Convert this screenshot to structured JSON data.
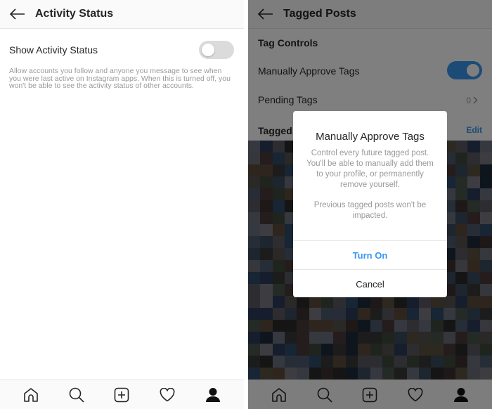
{
  "left_screen": {
    "header": {
      "title": "Activity Status",
      "back_icon": "arrow-left-icon"
    },
    "setting": {
      "label": "Show Activity Status",
      "enabled": false,
      "description": "Allow accounts you follow and anyone you message to see when you were last active on Instagram apps. When this is turned off, you won't be able to see the activity status of other accounts."
    },
    "bottom_nav": [
      "home-icon",
      "search-icon",
      "add-post-icon",
      "heart-icon",
      "profile-icon"
    ]
  },
  "right_screen": {
    "header": {
      "title": "Tagged Posts",
      "back_icon": "arrow-left-icon"
    },
    "section_tag_controls": "Tag Controls",
    "manual_approve": {
      "label": "Manually Approve Tags",
      "enabled": true
    },
    "pending_tags": {
      "label": "Pending Tags",
      "count": "0"
    },
    "tagged_section": {
      "label": "Tagged Posts",
      "edit_label": "Edit"
    },
    "dialog": {
      "title": "Manually Approve Tags",
      "body": "Control every future tagged post. You'll be able to manually add them to your profile, or permanently remove yourself.",
      "note": "Previous tagged posts won't be impacted.",
      "primary_button": "Turn On",
      "secondary_button": "Cancel"
    },
    "bottom_nav": [
      "home-icon",
      "search-icon",
      "add-post-icon",
      "heart-icon",
      "profile-icon"
    ]
  },
  "colors": {
    "accent": "#3897f0",
    "toggle_on": "#3897f0",
    "toggle_off": "#dbdbdb",
    "text_primary": "#262626",
    "text_secondary": "#999999"
  }
}
